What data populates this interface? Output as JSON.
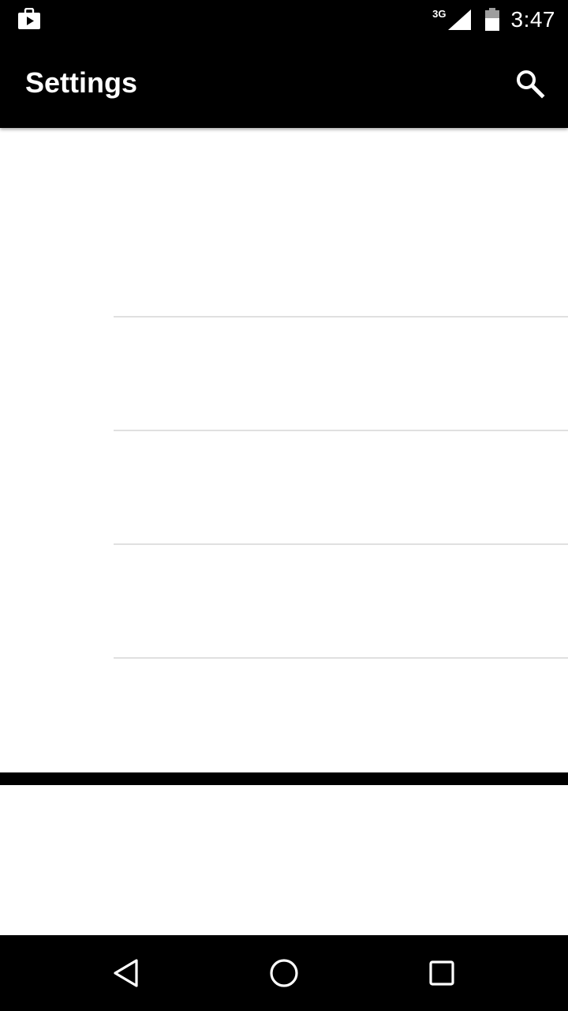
{
  "status_bar": {
    "notification_icon": "play-store-bag-icon",
    "network_type": "3G",
    "signal_icon": "cell-signal-icon",
    "battery_icon": "battery-icon",
    "time": "3:47"
  },
  "app_bar": {
    "title": "Settings",
    "search_icon": "search-icon"
  },
  "list": {
    "rows": 5
  },
  "nav_bar": {
    "back_icon": "back-triangle-icon",
    "home_icon": "home-circle-icon",
    "recents_icon": "recents-square-icon"
  },
  "colors": {
    "bar_background": "#000000",
    "content_background": "#ffffff",
    "divider": "#e0e0e0",
    "icon": "#ffffff"
  }
}
